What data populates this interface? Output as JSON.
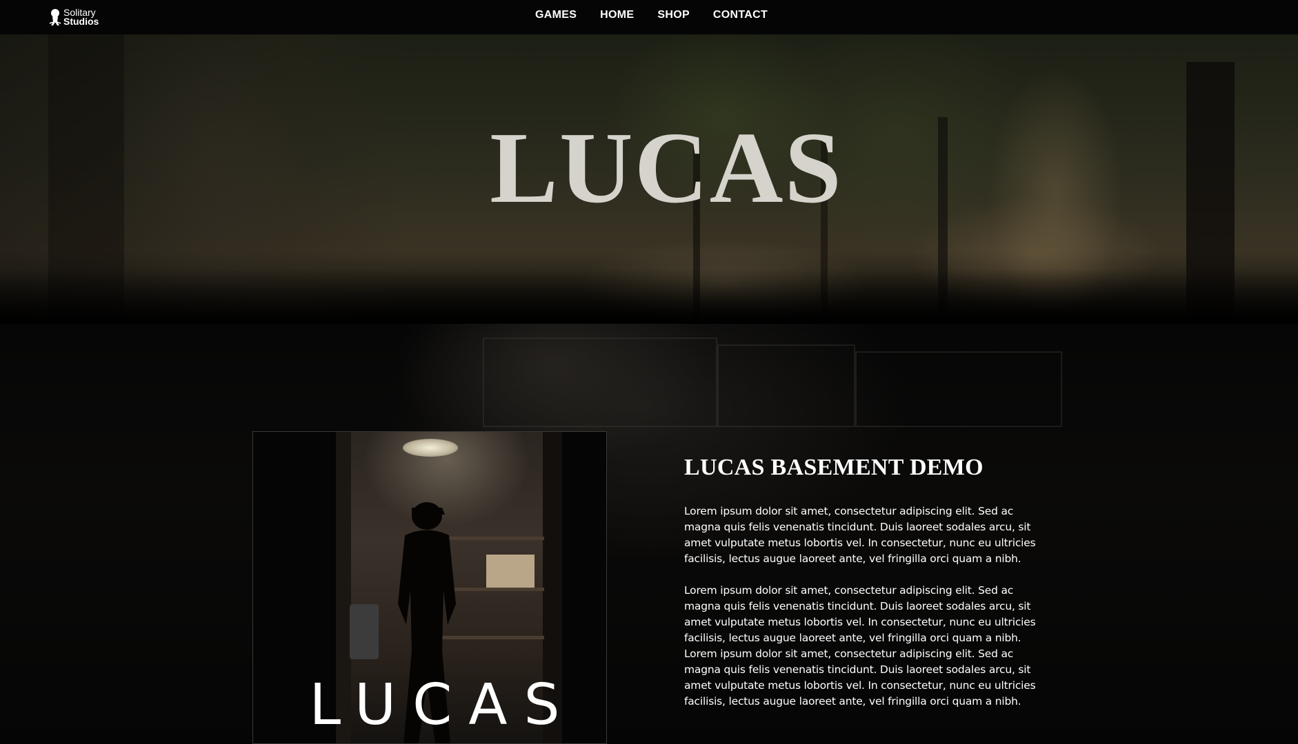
{
  "nav": {
    "logo": {
      "line1": "Solitary",
      "line2": "Studios",
      "icon": "solitary-figure-icon"
    },
    "links": [
      {
        "label": "GAMES"
      },
      {
        "label": "HOME"
      },
      {
        "label": "SHOP"
      },
      {
        "label": "CONTACT"
      }
    ]
  },
  "hero": {
    "title": "LUCAS"
  },
  "cover": {
    "title": "LUCAS"
  },
  "info": {
    "title": "LUCAS BASEMENT DEMO",
    "paragraph1": "Lorem ipsum dolor sit amet, consectetur adipiscing elit. Sed ac magna quis felis venenatis tincidunt. Duis laoreet sodales arcu, sit amet vulputate metus lobortis vel. In consectetur, nunc eu ultricies facilisis, lectus augue laoreet ante, vel fringilla orci quam a nibh.",
    "paragraph2": "Lorem ipsum dolor sit amet, consectetur adipiscing elit. Sed ac magna quis felis venenatis tincidunt. Duis laoreet sodales arcu, sit amet vulputate metus lobortis vel. In consectetur, nunc eu ultricies facilisis, lectus augue laoreet ante, vel fringilla orci quam a nibh. Lorem ipsum dolor sit amet, consectetur adipiscing elit. Sed ac magna quis felis venenatis tincidunt. Duis laoreet sodales arcu, sit amet vulputate metus lobortis vel. In consectetur, nunc eu ultricies facilisis, lectus augue laoreet ante, vel fringilla orci quam a nibh."
  },
  "colors": {
    "background": "#000000",
    "nav_background": "#050505",
    "hero_title": "#d6d3cc",
    "text": "#ffffff"
  }
}
